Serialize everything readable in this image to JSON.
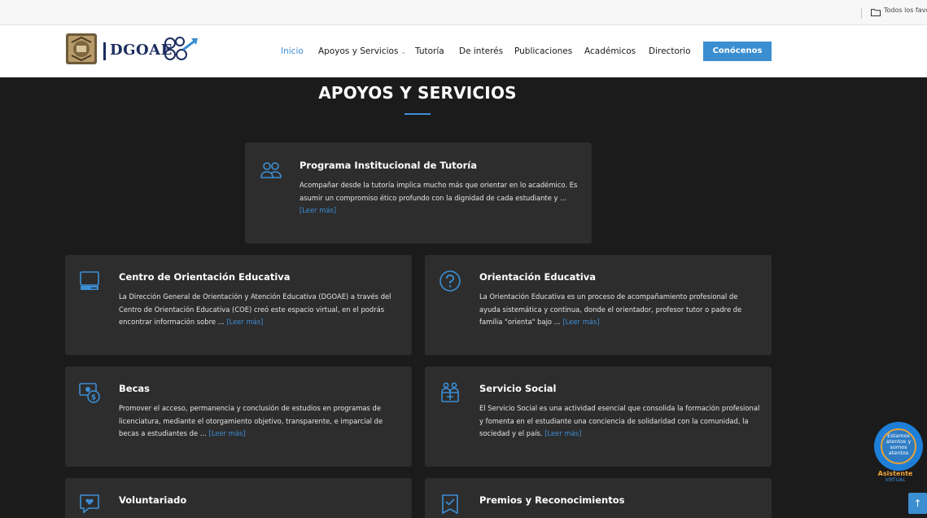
{
  "favorites_bar": {
    "label": "Todos los favoritos",
    "icon": "folder-icon"
  },
  "header": {
    "logo": {
      "text": "DGOAE",
      "seal_icon": "university-seal-icon",
      "swirl_icon": "dgoae-swirl-icon"
    },
    "nav": [
      {
        "label": "Inicio",
        "active": true
      },
      {
        "label": "Apoyos y Servicios",
        "has_dropdown": true
      },
      {
        "label": "Tutoría"
      },
      {
        "label": "De interés"
      },
      {
        "label": "Publicaciones"
      },
      {
        "label": "Académicos"
      },
      {
        "label": "Directorio"
      }
    ],
    "cta_label": "Conócenos"
  },
  "section": {
    "title": "APOYOS Y SERVICIOS"
  },
  "cards": [
    {
      "icon": "users-icon",
      "title": "Programa Institucional de Tutoría",
      "description": "Acompañar desde la tutoría implica mucho más que orientar en lo académico. Es asumir un compromiso ético profundo con la dignidad de cada estudiante y ...",
      "more": "[Leer más]"
    },
    {
      "icon": "computer-icon",
      "title": "Centro de Orientación Educativa",
      "description": "La Dirección General de Orientación y Atención Educativa (DGOAE) a través del Centro de Orientación Educativa (COE) creó este espacio virtual, en el podrás encontrar información sobre ...",
      "more": "[Leer más]"
    },
    {
      "icon": "question-icon",
      "title": "Orientación Educativa",
      "description": "La Orientación Educativa es un proceso de acompañamiento profesional de ayuda sistemática y continua, donde el orientador, profesor tutor o padre de familia \"orienta\" bajo ...",
      "more": "[Leer más]"
    },
    {
      "icon": "money-icon",
      "title": "Becas",
      "description": "Promover el acceso, permanencia y conclusión de estudios en programas de licenciatura, mediante el otorgamiento objetivo, transparente, e imparcial de becas a estudiantes de ...",
      "more": "[Leer más]"
    },
    {
      "icon": "community-icon",
      "title": "Servicio Social",
      "description": "El Servicio Social es una actividad esencial que consolida la formación profesional y fomenta en el estudiante una conciencia de solidaridad con la comunidad, la sociedad y el país.",
      "more": "[Leer más]"
    },
    {
      "icon": "heart-message-icon",
      "title": "Voluntariado",
      "description": "",
      "more": ""
    },
    {
      "icon": "award-icon",
      "title": "Premios y Reconocimientos",
      "description": "",
      "more": ""
    }
  ],
  "assistant": {
    "bubble_lines": [
      "Estamos",
      "atentos y",
      "somos",
      "atentos"
    ],
    "label": "Asistente",
    "sub": "VIRTUAL"
  },
  "back_to_top": {
    "icon": "arrow-up-icon"
  },
  "colors": {
    "accent": "#3d8fd6",
    "card_bg": "#2d2d2d",
    "page_bg": "#1b1b1b",
    "brand_navy": "#1c2d5e"
  }
}
